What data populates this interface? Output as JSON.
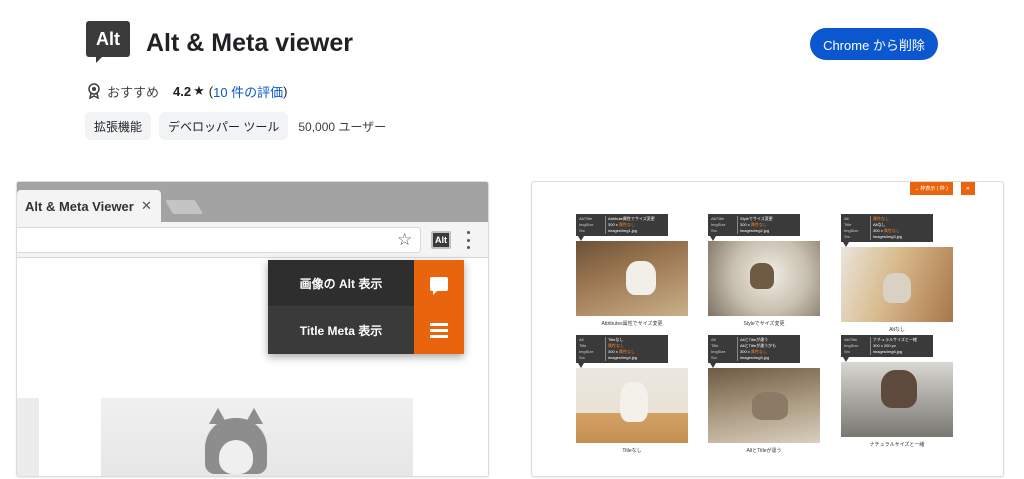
{
  "header": {
    "logo_text": "Alt",
    "title": "Alt & Meta viewer",
    "remove_button": "Chrome から削除"
  },
  "meta": {
    "featured_label": "おすすめ",
    "rating": "4.2",
    "rating_star": "★",
    "reviews_open": "(",
    "reviews_link": "10 件の評価",
    "reviews_close": ")"
  },
  "chips": {
    "category_1": "拡張機能",
    "category_2": "デベロッパー ツール",
    "users": "50,000 ユーザー"
  },
  "screenshot1": {
    "tab_title": "Alt & Meta Viewer",
    "tab_close": "✕",
    "bookmark_star": "☆",
    "extension_icon_text": "Alt",
    "popup_items": [
      {
        "label": "画像の Alt 表示",
        "icon": "speech-bubble-icon"
      },
      {
        "label": "Title Meta 表示",
        "icon": "list-icon"
      }
    ]
  },
  "screenshot2": {
    "top_buttons": [
      "⌄ 枠表示 ( 枠 )",
      "✕"
    ],
    "cells": [
      {
        "caption": "Attributes属性でサイズ変更",
        "info": [
          {
            "k": "Alt/Title",
            "v": "Attribute属性でサイズ変更",
            "hl": ""
          },
          {
            "k": "ImgSize",
            "v": "300 x ",
            "hl": "属性なし"
          },
          {
            "k": "Src",
            "v": "images/img1.jpg",
            "hl": ""
          }
        ]
      },
      {
        "caption": "Styleでサイズ変更",
        "info": [
          {
            "k": "Alt/Title",
            "v": "Styleでサイズ変更",
            "hl": ""
          },
          {
            "k": "ImgSize",
            "v": "300 x ",
            "hl": "属性なし"
          },
          {
            "k": "Src",
            "v": "images/img2.jpg",
            "hl": ""
          }
        ]
      },
      {
        "caption": "Altなし",
        "info": [
          {
            "k": "Alt",
            "v": "",
            "hl": "属性なし"
          },
          {
            "k": "Title",
            "v": "Altなし",
            "hl": ""
          },
          {
            "k": "ImgSize",
            "v": "300 x ",
            "hl": "属性なし"
          },
          {
            "k": "Src",
            "v": "images/img3.jpg",
            "hl": ""
          }
        ]
      },
      {
        "caption": "Titleなし",
        "info": [
          {
            "k": "Alt",
            "v": "Titleなし",
            "hl": ""
          },
          {
            "k": "Title",
            "v": "",
            "hl": "属性なし"
          },
          {
            "k": "ImgSize",
            "v": "300 x ",
            "hl": "属性なし"
          },
          {
            "k": "Src",
            "v": "images/img4.jpg",
            "hl": ""
          }
        ]
      },
      {
        "caption": "AltとTitleが違う",
        "info": [
          {
            "k": "Alt",
            "v": "AltとTitleが違う",
            "hl": ""
          },
          {
            "k": "Title",
            "v": "AltとTitleが違うかも",
            "hl": ""
          },
          {
            "k": "ImgSize",
            "v": "300 x ",
            "hl": "属性なし"
          },
          {
            "k": "Src",
            "v": "images/img5.jpg",
            "hl": ""
          }
        ]
      },
      {
        "caption": "ナチュラルサイズと一緒",
        "info": [
          {
            "k": "Alt/Title",
            "v": "ナチュラルサイズと一緒",
            "hl": ""
          },
          {
            "k": "ImgSize",
            "v": "300 x 200 px",
            "hl": ""
          },
          {
            "k": "Src",
            "v": "images/img6.jpg",
            "hl": ""
          }
        ]
      }
    ]
  }
}
